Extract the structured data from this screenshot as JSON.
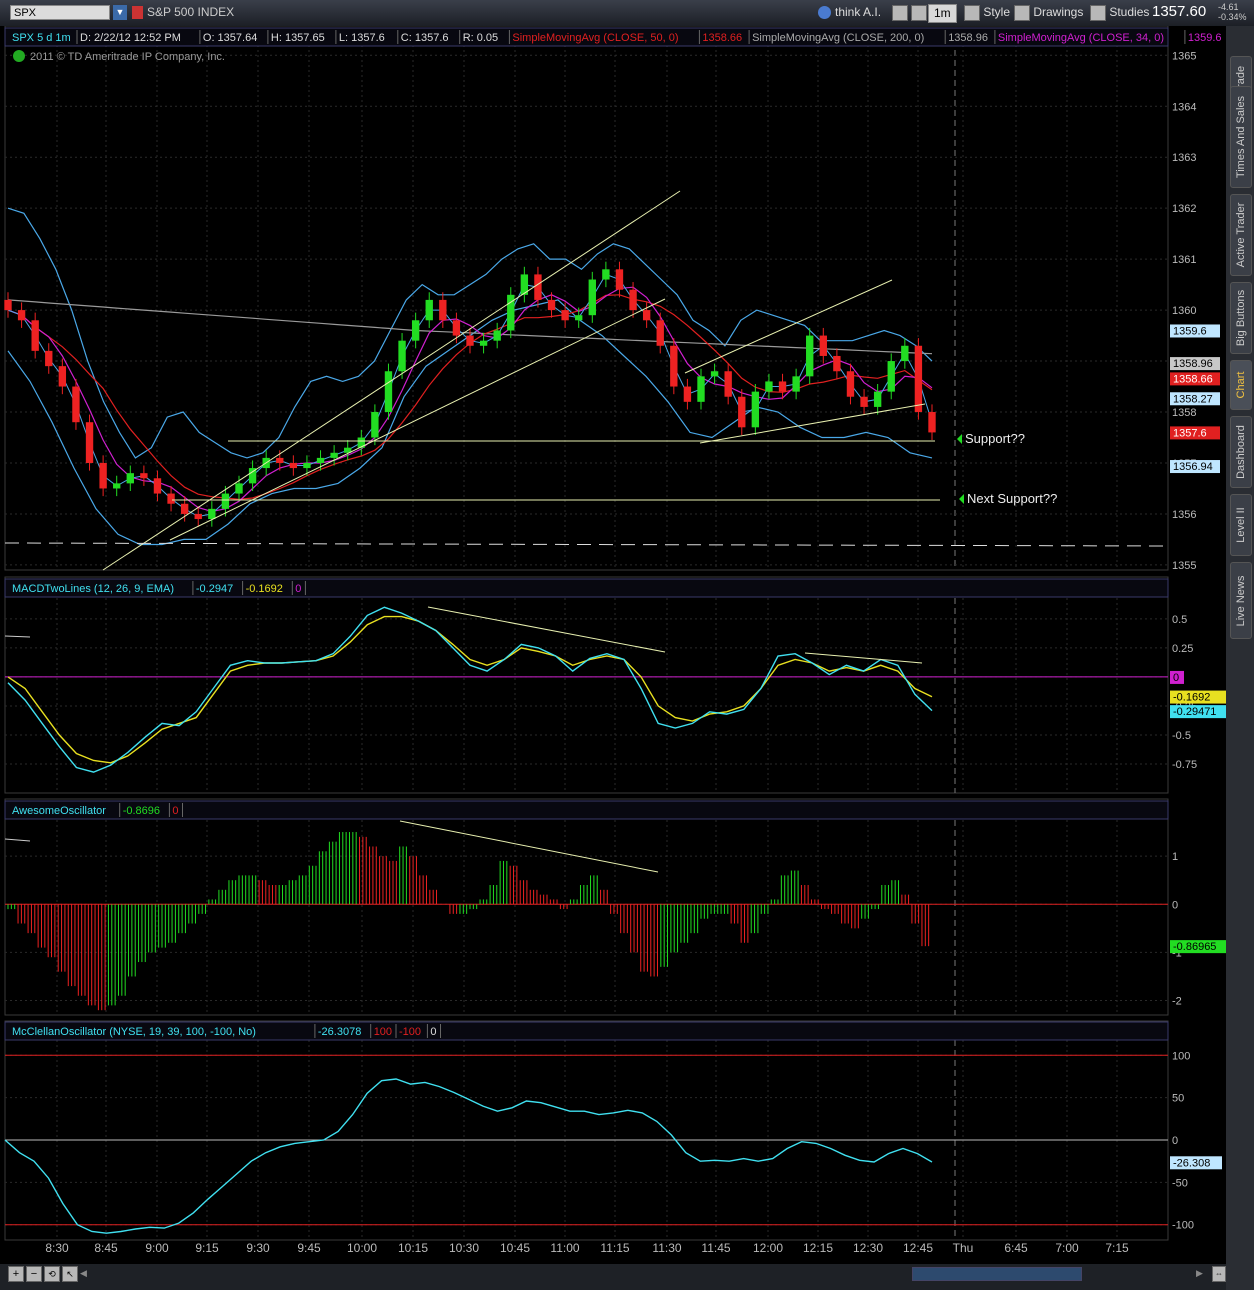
{
  "toolbar": {
    "symbol": "SPX",
    "symbol_name": "S&P 500 INDEX",
    "think_ai": "think A.I.",
    "timeframe": "1m",
    "style": "Style",
    "drawings": "Drawings",
    "studies": "Studies",
    "last_price": "1357.60",
    "change": "-4.61",
    "change_pct": "-0.34%"
  },
  "right_tabs": [
    {
      "label": "Trade",
      "active": false
    },
    {
      "label": "Times And Sales",
      "active": false
    },
    {
      "label": "Active Trader",
      "active": false
    },
    {
      "label": "Big Buttons",
      "active": false
    },
    {
      "label": "Chart",
      "active": true
    },
    {
      "label": "Dashboard",
      "active": false
    },
    {
      "label": "Level II",
      "active": false
    },
    {
      "label": "Live News",
      "active": false
    }
  ],
  "price_header": {
    "symbol_tf": "SPX 5 d 1m",
    "date": "D: 2/22/12 12:52 PM",
    "open": "O: 1357.64",
    "high": "H: 1357.65",
    "low": "L: 1357.6",
    "close": "C: 1357.6",
    "range": "R: 0.05",
    "sma50": "SimpleMovingAvg (CLOSE, 50, 0)",
    "sma50_val": "1358.66",
    "sma200": "SimpleMovingAvg (CLOSE, 200, 0)",
    "sma200_val": "1358.96",
    "sma34": "SimpleMovingAvg (CLOSE, 34, 0)",
    "sma34_val": "1359.6",
    "copyright": "2011 © TD Ameritrade IP Company, Inc."
  },
  "macd_header": {
    "name": "MACDTwoLines (12, 26, 9, EMA)",
    "v1": "-0.2947",
    "v2": "-0.1692",
    "v3": "0"
  },
  "ao_header": {
    "name": "AwesomeOscillator",
    "v1": "-0.8696",
    "v2": "0"
  },
  "mcc_header": {
    "name": "McClellanOscillator (NYSE, 19, 39, 100, -100, No)",
    "v1": "-26.3078",
    "v2": "100",
    "v3": "-100",
    "v4": "0"
  },
  "annotations": {
    "support": "Support??",
    "next_support": "Next Support??"
  },
  "colors": {
    "bull": "#22dd22",
    "bear": "#ee2222",
    "bollinger": "#4aa8e8",
    "sma50": "#e02020",
    "sma200": "#9a9a9a",
    "sma34": "#d020d0",
    "trend": "#e8f0b0",
    "macd": "#40e0f0",
    "signal": "#e8e020",
    "zero_macd": "#d020d0",
    "mcc": "#40e0f0",
    "mcc_bounds": "#e02020"
  },
  "chart_data": [
    {
      "type": "candlestick",
      "title": "SPX 5 d 1m",
      "xticks": [
        "8:30",
        "8:45",
        "9:00",
        "9:15",
        "9:30",
        "9:45",
        "10:00",
        "10:15",
        "10:30",
        "10:45",
        "11:00",
        "11:15",
        "11:30",
        "11:45",
        "12:00",
        "12:15",
        "12:30",
        "12:45",
        "Thu",
        "6:45",
        "7:00",
        "7:15"
      ],
      "yticks": [
        1355,
        1356,
        1357,
        1358,
        1359,
        1360,
        1361,
        1362,
        1363,
        1364,
        1365
      ],
      "ylim": [
        1354.9,
        1365.3
      ],
      "price_labels": {
        "sma34": 1359.6,
        "sma200": 1358.96,
        "sma50": 1358.66,
        "bb_mid": 1358.27,
        "last": 1357.6,
        "bb_low": 1356.94
      },
      "close": [
        1360.0,
        1359.8,
        1359.2,
        1358.9,
        1358.5,
        1357.8,
        1357.0,
        1356.5,
        1356.6,
        1356.8,
        1356.7,
        1356.4,
        1356.2,
        1356.0,
        1355.9,
        1356.1,
        1356.4,
        1356.6,
        1356.9,
        1357.1,
        1357.0,
        1356.9,
        1357.0,
        1357.1,
        1357.2,
        1357.3,
        1357.5,
        1358.0,
        1358.8,
        1359.4,
        1359.8,
        1360.2,
        1359.8,
        1359.5,
        1359.3,
        1359.4,
        1359.6,
        1360.3,
        1360.7,
        1360.2,
        1360.0,
        1359.8,
        1359.9,
        1360.6,
        1360.8,
        1360.4,
        1360.0,
        1359.8,
        1359.3,
        1358.5,
        1358.2,
        1358.7,
        1358.8,
        1358.3,
        1357.7,
        1358.4,
        1358.6,
        1358.4,
        1358.7,
        1359.5,
        1359.1,
        1358.8,
        1358.3,
        1358.1,
        1358.4,
        1359.0,
        1359.3,
        1358.0,
        1357.6
      ],
      "bb_upper": [
        1362.0,
        1361.9,
        1361.4,
        1360.8,
        1360.0,
        1359.0,
        1358.2,
        1357.6,
        1357.1,
        1357.3,
        1357.9,
        1358.0,
        1357.6,
        1357.4,
        1357.2,
        1357.1,
        1357.2,
        1357.5,
        1358.1,
        1358.6,
        1358.7,
        1358.6,
        1358.7,
        1359.0,
        1359.6,
        1360.2,
        1360.5,
        1360.3,
        1360.3,
        1360.5,
        1360.7,
        1361.0,
        1361.2,
        1361.3,
        1361.0,
        1361.0,
        1360.8,
        1361.1,
        1361.3,
        1361.2,
        1360.9,
        1360.6,
        1360.3,
        1359.8,
        1359.6,
        1359.3,
        1359.8,
        1360.0,
        1359.9,
        1359.8,
        1359.7,
        1359.4,
        1359.4,
        1359.4,
        1359.5,
        1359.6,
        1359.5,
        1359.3,
        1359.0
      ],
      "bb_lower": [
        1359.2,
        1358.6,
        1357.8,
        1356.9,
        1356.1,
        1355.6,
        1355.4,
        1355.4,
        1355.5,
        1355.5,
        1355.8,
        1356.2,
        1356.4,
        1356.5,
        1356.5,
        1356.6,
        1356.9,
        1357.3,
        1358.3,
        1358.9,
        1359.2,
        1359.5,
        1359.8,
        1360.0,
        1360.1,
        1360.2,
        1359.8,
        1359.5,
        1359.1,
        1358.7,
        1358.2,
        1357.6,
        1357.5,
        1357.8,
        1358.1,
        1358.0,
        1357.7,
        1357.5,
        1357.5,
        1357.6,
        1357.5,
        1357.2,
        1357.1
      ]
    },
    {
      "type": "line",
      "title": "MACDTwoLines (12, 26, 9, EMA)",
      "yticks": [
        -0.75,
        -0.5,
        -0.25,
        0,
        0.25,
        0.5
      ],
      "ylim": [
        -1.0,
        0.68
      ],
      "value": -0.29471,
      "avg": -0.1692,
      "series": [
        {
          "name": "Value",
          "values": [
            -0.05,
            -0.2,
            -0.4,
            -0.6,
            -0.78,
            -0.82,
            -0.76,
            -0.65,
            -0.52,
            -0.4,
            -0.42,
            -0.3,
            -0.1,
            0.1,
            0.14,
            0.12,
            0.12,
            0.13,
            0.14,
            0.2,
            0.35,
            0.53,
            0.6,
            0.55,
            0.48,
            0.4,
            0.25,
            0.1,
            0.05,
            0.15,
            0.28,
            0.25,
            0.18,
            0.05,
            0.16,
            0.2,
            0.15,
            -0.1,
            -0.4,
            -0.44,
            -0.4,
            -0.3,
            -0.32,
            -0.28,
            -0.1,
            0.18,
            0.2,
            0.12,
            0.02,
            0.1,
            0.05,
            0.15,
            0.1,
            -0.15,
            -0.29
          ]
        },
        {
          "name": "Avg",
          "values": [
            0.0,
            -0.1,
            -0.3,
            -0.5,
            -0.66,
            -0.72,
            -0.74,
            -0.68,
            -0.57,
            -0.45,
            -0.4,
            -0.35,
            -0.15,
            0.05,
            0.1,
            0.12,
            0.12,
            0.13,
            0.14,
            0.18,
            0.3,
            0.45,
            0.52,
            0.52,
            0.48,
            0.4,
            0.28,
            0.15,
            0.1,
            0.15,
            0.25,
            0.22,
            0.18,
            0.1,
            0.15,
            0.18,
            0.15,
            0.0,
            -0.25,
            -0.35,
            -0.38,
            -0.32,
            -0.3,
            -0.25,
            -0.1,
            0.1,
            0.15,
            0.12,
            0.05,
            0.08,
            0.05,
            0.1,
            0.05,
            -0.1,
            -0.17
          ]
        }
      ]
    },
    {
      "type": "bar",
      "title": "AwesomeOscillator",
      "yticks": [
        -2,
        -1,
        0,
        1
      ],
      "ylim": [
        -2.3,
        1.75
      ],
      "value": -0.86965,
      "values": [
        -0.1,
        -0.4,
        -0.6,
        -0.9,
        -1.1,
        -1.4,
        -1.7,
        -1.9,
        -2.1,
        -2.2,
        -2.1,
        -1.9,
        -1.5,
        -1.2,
        -1.0,
        -0.9,
        -0.8,
        -0.6,
        -0.4,
        -0.2,
        0.1,
        0.3,
        0.5,
        0.6,
        0.6,
        0.5,
        0.4,
        0.4,
        0.5,
        0.6,
        0.8,
        1.1,
        1.3,
        1.5,
        1.5,
        1.4,
        1.2,
        1.0,
        0.9,
        1.2,
        1.0,
        0.6,
        0.3,
        0.0,
        -0.2,
        -0.2,
        -0.1,
        0.1,
        0.4,
        0.9,
        0.8,
        0.5,
        0.3,
        0.2,
        0.1,
        -0.1,
        0.1,
        0.4,
        0.6,
        0.3,
        -0.2,
        -0.6,
        -1.0,
        -1.4,
        -1.5,
        -1.3,
        -1.0,
        -0.8,
        -0.6,
        -0.3,
        -0.2,
        -0.2,
        -0.4,
        -0.8,
        -0.6,
        -0.2,
        0.1,
        0.6,
        0.7,
        0.4,
        0.1,
        -0.1,
        -0.2,
        -0.4,
        -0.5,
        -0.3,
        -0.1,
        0.4,
        0.5,
        0.2,
        -0.4,
        -0.87
      ]
    },
    {
      "type": "line",
      "title": "McClellanOscillator (NYSE, 19, 39, 100, -100, No)",
      "yticks": [
        -100,
        -50,
        0,
        50,
        100
      ],
      "ylim": [
        -118,
        118
      ],
      "value": -26.308,
      "values": [
        0,
        -15,
        -25,
        -45,
        -75,
        -100,
        -108,
        -110,
        -108,
        -105,
        -103,
        -104,
        -98,
        -86,
        -70,
        -55,
        -40,
        -25,
        -15,
        -8,
        -4,
        -2,
        0,
        10,
        30,
        55,
        70,
        72,
        66,
        68,
        63,
        56,
        48,
        40,
        34,
        38,
        46,
        44,
        39,
        34,
        34,
        30,
        32,
        35,
        32,
        22,
        6,
        -15,
        -25,
        -24,
        -25,
        -22,
        -25,
        -22,
        -10,
        -2,
        -4,
        -10,
        -18,
        -24,
        -26,
        -16,
        -10,
        -16,
        -26
      ]
    }
  ]
}
